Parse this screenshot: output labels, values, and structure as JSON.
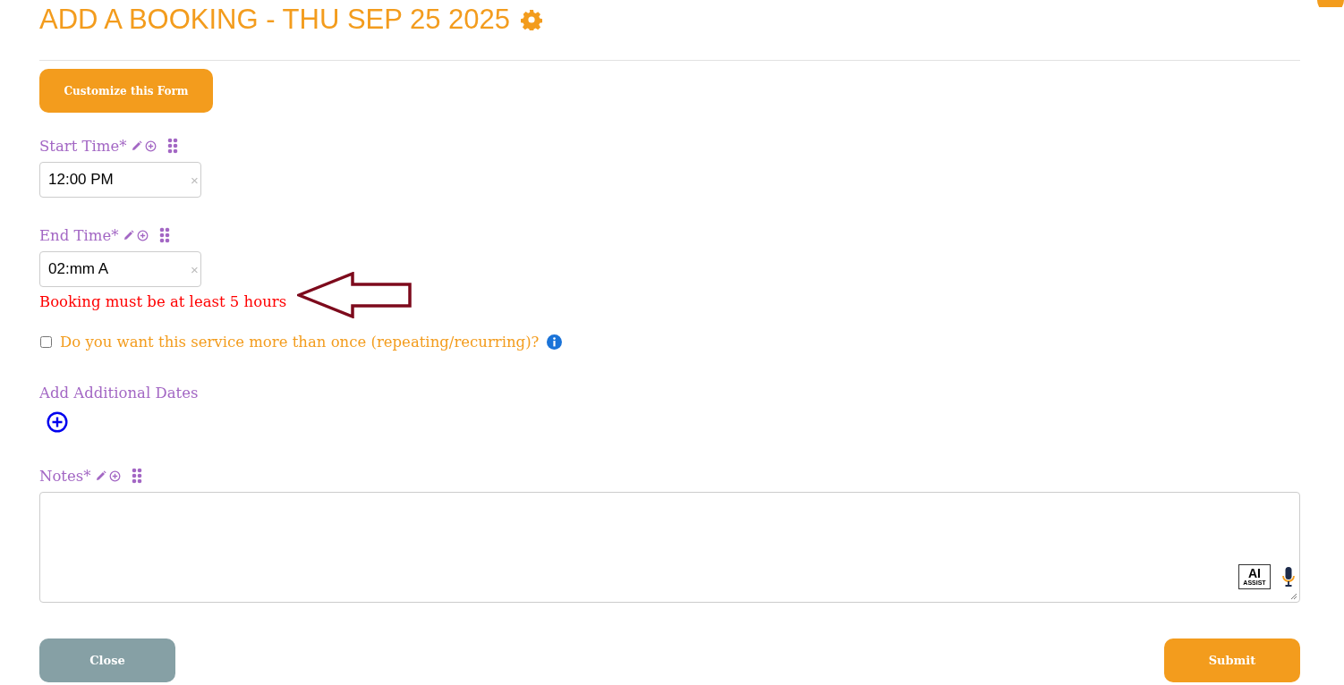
{
  "title": "ADD A BOOKING - THU SEP 25 2025",
  "customize_button": "Customize this Form",
  "fields": [
    {
      "kind": "time",
      "label": "Start Time*",
      "value": "12:00 PM",
      "clear": "×"
    },
    {
      "kind": "time",
      "label": "End Time*",
      "value": "02:mm A",
      "clear": "×",
      "error": "Booking must be at least 5 hours"
    },
    {
      "kind": "checkbox",
      "label": "Do you want this service more than once (repeating/recurring)?",
      "checked": false
    },
    {
      "kind": "add",
      "label": "Add Additional Dates"
    },
    {
      "kind": "textarea",
      "label": "Notes*",
      "ai_label": "AI",
      "ai_sublabel": "ASSIST"
    }
  ],
  "footer": {
    "close": "Close",
    "submit": "Submit"
  }
}
